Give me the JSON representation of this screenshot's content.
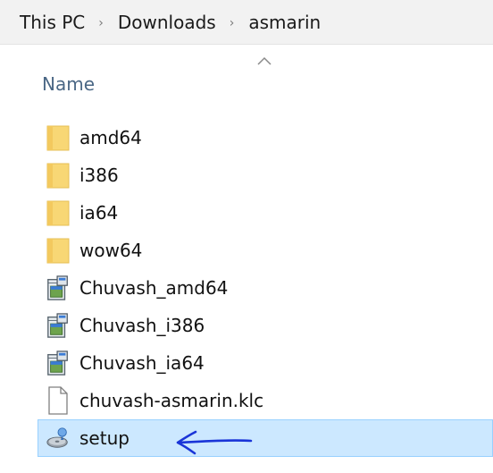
{
  "breadcrumb": {
    "items": [
      "This PC",
      "Downloads",
      "asmarin"
    ],
    "separator": "›"
  },
  "file_list": {
    "column_header": "Name",
    "sort_indicator_icon": "sort-ascending-icon",
    "items": [
      {
        "name": "amd64",
        "type": "folder",
        "icon": "folder-icon"
      },
      {
        "name": "i386",
        "type": "folder",
        "icon": "folder-icon"
      },
      {
        "name": "ia64",
        "type": "folder",
        "icon": "folder-icon"
      },
      {
        "name": "wow64",
        "type": "folder",
        "icon": "folder-icon"
      },
      {
        "name": "Chuvash_amd64",
        "type": "installer",
        "icon": "installer-package-icon"
      },
      {
        "name": "Chuvash_i386",
        "type": "installer",
        "icon": "installer-package-icon"
      },
      {
        "name": "Chuvash_ia64",
        "type": "installer",
        "icon": "installer-package-icon"
      },
      {
        "name": "chuvash-asmarin.klc",
        "type": "file",
        "icon": "document-icon"
      },
      {
        "name": "setup",
        "type": "application",
        "icon": "setup-disc-icon",
        "selected": true
      }
    ]
  },
  "colors": {
    "folder": "#f8d775",
    "selection_bg": "#cce8ff",
    "selection_border": "#99d1ff",
    "annotation_arrow": "#1a35d8",
    "header_text": "#4a6785"
  },
  "annotation": {
    "icon": "hand-drawn-arrow-icon",
    "points_to": "setup"
  }
}
